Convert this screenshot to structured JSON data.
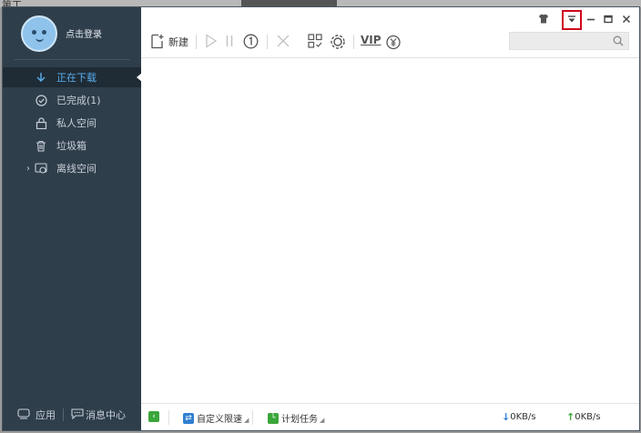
{
  "background": {
    "behind_text": "第工"
  },
  "sidebar": {
    "login_label": "点击登录",
    "items": [
      {
        "label": "正在下载",
        "icon": "download-icon",
        "active": true
      },
      {
        "label": "已完成(1)",
        "icon": "check-circle-icon",
        "active": false
      },
      {
        "label": "私人空间",
        "icon": "lock-icon",
        "active": false
      },
      {
        "label": "垃圾箱",
        "icon": "trash-icon",
        "active": false
      },
      {
        "label": "离线空间",
        "icon": "cloud-icon",
        "active": false
      }
    ],
    "bottom": {
      "apps_label": "应用",
      "messages_label": "消息中心"
    }
  },
  "toolbar": {
    "new_label": "新建",
    "vip_label": "VIP"
  },
  "statusbar": {
    "speed_limit_label": "自定义限速",
    "schedule_label": "计划任务",
    "download_speed": "0KB/s",
    "upload_speed": "0KB/s"
  },
  "colors": {
    "sidebar_bg": "#2f3e4b",
    "active_text": "#5ab0f0",
    "highlight_box": "#d0021b",
    "green": "#3aa63a"
  }
}
